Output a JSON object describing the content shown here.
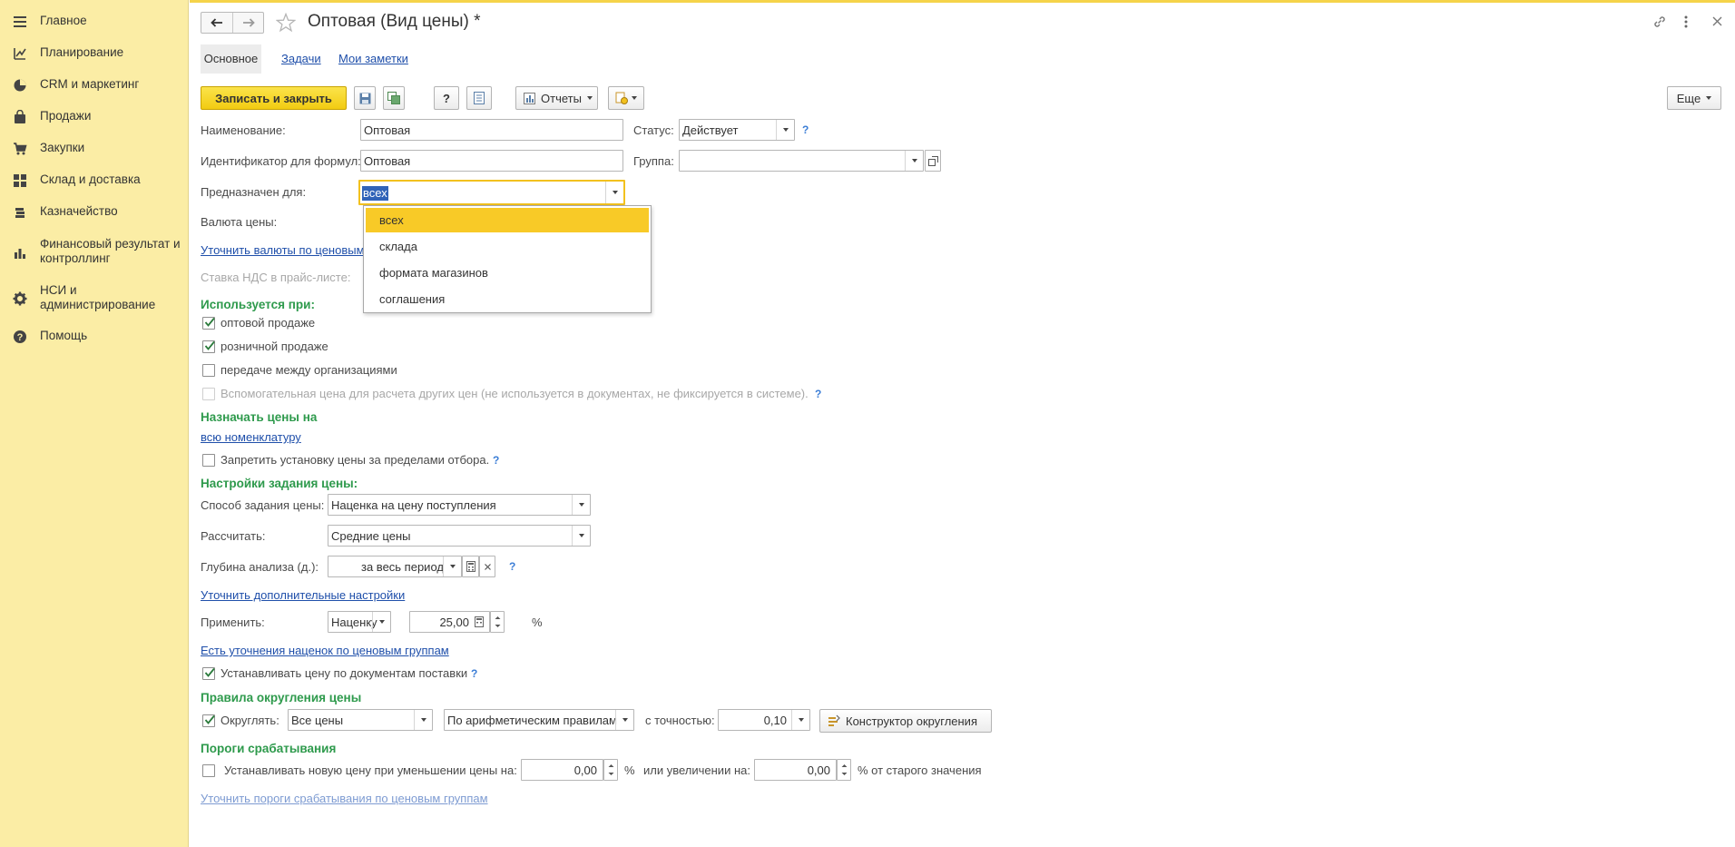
{
  "sidebar": {
    "items": [
      {
        "label": "Главное",
        "icon": "menu-icon"
      },
      {
        "label": "Планирование",
        "icon": "planning-icon"
      },
      {
        "label": "CRM и маркетинг",
        "icon": "pie-chart-icon"
      },
      {
        "label": "Продажи",
        "icon": "bag-icon"
      },
      {
        "label": "Закупки",
        "icon": "cart-icon"
      },
      {
        "label": "Склад и доставка",
        "icon": "grid-icon"
      },
      {
        "label": "Казначейство",
        "icon": "coins-icon"
      },
      {
        "label": "Финансовый результат и контроллинг",
        "icon": "bar-chart-icon"
      },
      {
        "label": "НСИ и администрирование",
        "icon": "gear-icon"
      },
      {
        "label": "Помощь",
        "icon": "help-icon"
      }
    ]
  },
  "header": {
    "title": "Оптовая (Вид цены) *"
  },
  "tabs": [
    {
      "label": "Основное",
      "active": true
    },
    {
      "label": "Задачи",
      "active": false
    },
    {
      "label": "Мои заметки",
      "active": false
    }
  ],
  "toolbar": {
    "save_close": "Записать и закрыть",
    "help": "?",
    "reports": "Отчеты",
    "more": "Еще"
  },
  "form": {
    "name_label": "Наименование:",
    "name_value": "Оптовая",
    "status_label": "Статус:",
    "status_value": "Действует",
    "formula_id_label": "Идентификатор для формул:",
    "formula_id_value": "Оптовая",
    "group_label": "Группа:",
    "group_value": "",
    "intended_label": "Предназначен для:",
    "intended_value": "всех",
    "currency_label": "Валюта цены:",
    "currency_link": "Уточнить валюты по ценовым",
    "vat_label": "Ставка НДС в прайс-листе:"
  },
  "dropdown": {
    "options": [
      "всех",
      "склада",
      "формата магазинов",
      "соглашения"
    ],
    "selected": 0
  },
  "used_in": {
    "title": "Используется при:",
    "options": [
      {
        "label": "оптовой продаже",
        "checked": true,
        "disabled": false
      },
      {
        "label": "розничной продаже",
        "checked": true,
        "disabled": false
      },
      {
        "label": "передаче между организациями",
        "checked": false,
        "disabled": false
      },
      {
        "label": "Вспомогательная цена для расчета других цен (не используется в документах, не фиксируется в системе).",
        "checked": false,
        "disabled": true
      }
    ]
  },
  "assign": {
    "title": "Назначать цены на",
    "link": "всю номенклатуру",
    "forbid_label": "Запретить установку цены за пределами отбора."
  },
  "price_settings": {
    "title": "Настройки задания цены:",
    "method_label": "Способ задания цены:",
    "method_value": "Наценка на цену поступления",
    "calc_label": "Рассчитать:",
    "calc_value": "Средние цены",
    "depth_label": "Глубина анализа (д.):",
    "depth_value": "за весь период",
    "extra_link": "Уточнить дополнительные настройки",
    "apply_label": "Применить:",
    "apply_type": "Наценку",
    "apply_value": "25,00",
    "apply_unit": "%",
    "markup_link": "Есть уточнения наценок по ценовым группам",
    "set_by_docs_label": "Устанавливать цену по документам поставки"
  },
  "rounding": {
    "title": "Правила округления цены",
    "round_label": "Округлять:",
    "scope_value": "Все цены",
    "rule_value": "По арифметическим правилам",
    "precision_label": "с точностью:",
    "precision_value": "0,10",
    "constructor_label": "Конструктор округления"
  },
  "thresholds": {
    "title": "Пороги срабатывания",
    "decrease_label": "Устанавливать новую цену при уменьшении цены на:",
    "decrease_value": "0,00",
    "pct1": "%",
    "increase_label": "или увеличении на:",
    "increase_value": "0,00",
    "pct2": "% от старого значения",
    "groups_link": "Уточнить пороги срабатывания по ценовым группам"
  }
}
